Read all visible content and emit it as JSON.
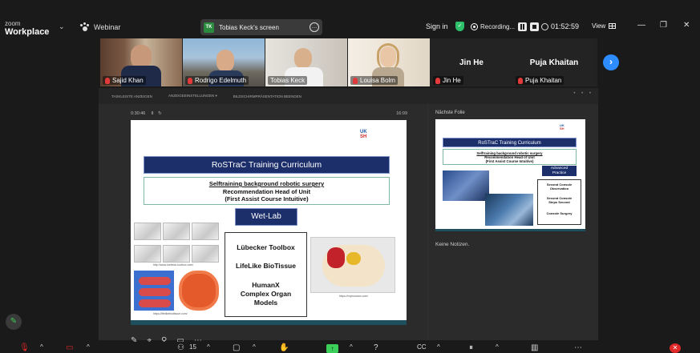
{
  "app": {
    "logo_line1": "zoom",
    "logo_line2": "Workplace",
    "mode": "Webinar",
    "share_label": "Tobias Keck's screen",
    "share_initials": "TK",
    "signin": "Sign in",
    "recording": "Recording...",
    "timer": "01:52:59",
    "view": "View"
  },
  "participants": [
    {
      "name": "Sajid Khan",
      "muted": true
    },
    {
      "name": "Rodrigo Edelmuth",
      "muted": true
    },
    {
      "name": "Tobias Keck",
      "muted": false
    },
    {
      "name": "Louisa Bolm",
      "muted": true
    },
    {
      "name": "Jin He",
      "muted": true
    },
    {
      "name": "Puja Khaitan",
      "muted": true
    }
  ],
  "ppt_toolbar": [
    "TASKLEISTE ANZEIGEN",
    "ANZEIGEEINSTELLUNGEN ▾",
    "BILDSCHIRMPRÄSENTATION BEENDEN"
  ],
  "presenter": {
    "elapsed": "0:30:46",
    "clock": "16:09"
  },
  "slide": {
    "logo": "UKSH",
    "title": "RoSTraC Training Curriculum",
    "subtitle_line1": "Selftraining background robotic surgery",
    "subtitle_line2": "Recommendation Head of Unit",
    "subtitle_line3": "(First Assist Course Intuitive)",
    "section": "Wet-Lab",
    "items": [
      "Lübecker Toolbox",
      "LifeLike BioTissue",
      "HumanX",
      "Complex Organ",
      "Models"
    ],
    "caption_toolbox": "http://www.luebeck-toolbox.com/",
    "caption_biotissue": "https://lifelikebiotissue.com/",
    "caption_humanx": "https://myhumanx.com/"
  },
  "next_slide": {
    "label": "Nächste Folie",
    "logo": "UKSH",
    "title": "RoSTraC Training Curriculum",
    "subtitle_line1": "Selftraining background robotic surgery",
    "subtitle_line2": "Recommendation Head of Unit",
    "subtitle_line3": "(First Assist Course Intuitive)",
    "advanced_line1": "Advanced",
    "advanced_line2": "Practice",
    "items": [
      "Second Console",
      "Observation",
      "Second Console",
      "Steps Second",
      "Console Surgery"
    ]
  },
  "notes": "Keine Notizen.",
  "toolbar": {
    "participant_count": "15"
  }
}
